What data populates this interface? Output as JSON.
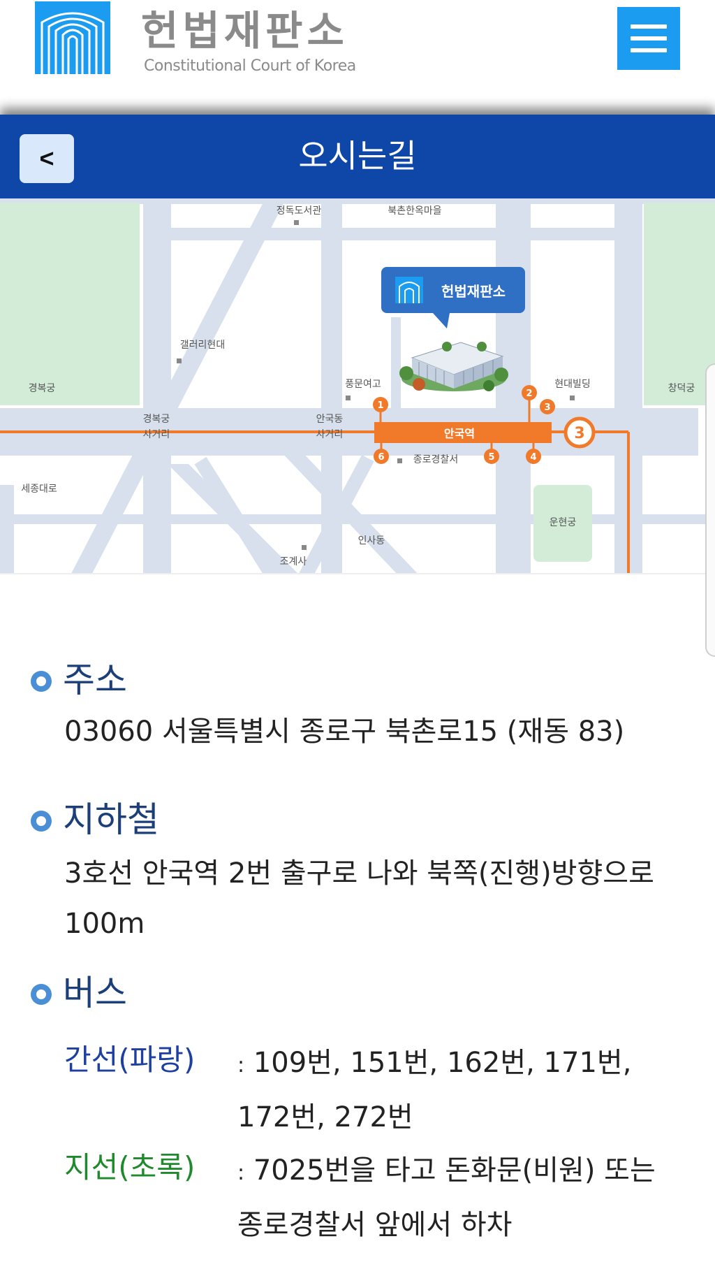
{
  "header": {
    "title": "헌법재판소",
    "subtitle": "Constitutional Court of Korea",
    "menu_icon": "hamburger-icon",
    "accent": "#1c9cf0"
  },
  "titlebar": {
    "back_label": "<",
    "title": "오시는길",
    "background": "#0f47a8"
  },
  "map": {
    "callout": "헌법재판소",
    "labels": {
      "jeongdok_library": "정독도서관",
      "bukchon_village": "북촌한옥마을",
      "gallery_hyundai": "갤러리현대",
      "gyeongbokgung": "경복궁",
      "pungmun_school": "풍문여고",
      "hyundai_building": "현대빌딩",
      "changdeokgung": "창덕궁",
      "gyeongbokgung_intersection": "경복궁\n사거리",
      "anguk_intersection": "안국동\n사거리",
      "anguk_station": "안국역",
      "jongno_police": "종로경찰서",
      "sejong_daero": "세종대로",
      "insadong": "인사동",
      "unhyeongung": "운현궁",
      "jogyesa": "조계사"
    },
    "exits": [
      "1",
      "2",
      "3",
      "4",
      "5",
      "6"
    ],
    "line_number": "3",
    "line_color": "#f07a2a",
    "park_color": "#d3ecd8",
    "road_color": "#d7e0ec"
  },
  "address": {
    "title": "주소",
    "text": "03060 서울특별시 종로구 북촌로15 (재동 83)"
  },
  "subway": {
    "title": "지하철",
    "text": "3호선 안국역 2번 출구로 나와 북쪽(진행)방향으로 100m"
  },
  "bus": {
    "title": "버스",
    "trunk_label": "간선(파랑)",
    "trunk_text": "109번, 151번, 162번, 171번, 172번, 272번",
    "branch_label": "지선(초록)",
    "branch_text": "7025번을 타고 돈화문(비원) 또는 종로경찰서 앞에서 하차",
    "colon": ":",
    "trunk_color": "#1d3fa0",
    "branch_color": "#1f8a2c"
  }
}
